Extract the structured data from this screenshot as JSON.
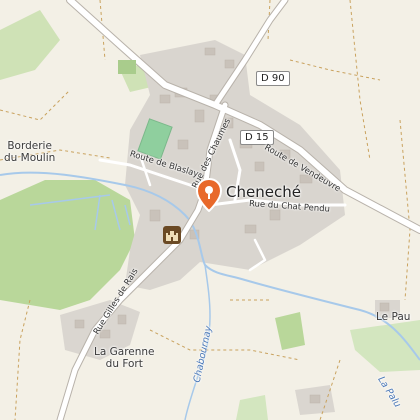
{
  "map": {
    "town": "Cheneché",
    "places": {
      "borderie": [
        "Borderie",
        "du Moulin"
      ],
      "garenne": [
        "La Garenne",
        "du Fort"
      ],
      "le_pau": "Le Pau"
    },
    "roads": {
      "d90": "D 90",
      "d15": "D 15",
      "route_blaslay": "Route de Blaslay",
      "rue_chaumes": "Rue des Chaumes",
      "route_vendeuvre": "Route de Vendeuvre",
      "rue_chat_pendu": "Rue du Chat Pendu",
      "rue_gilles_rais": "Rue Gilles de Rais"
    },
    "waterways": {
      "chabournay": "Chabournay",
      "la_palu": "La Palu"
    },
    "icons": {
      "selected_pin": "map-pin-icon",
      "castle": "castle-icon"
    },
    "colors": {
      "pin": "#e8692b",
      "road_main": "#ffffff",
      "water": "#a7c9ea",
      "forest": "#b9d79a",
      "built": "#d9d5cf",
      "trail": "#c9a25e"
    }
  }
}
